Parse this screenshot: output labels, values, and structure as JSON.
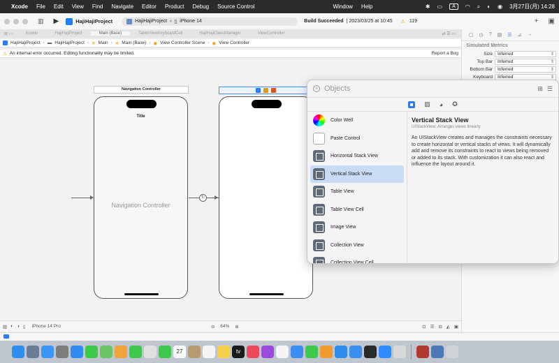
{
  "menubar": {
    "app": "Xcode",
    "items": [
      "File",
      "Edit",
      "View",
      "Find",
      "Navigate",
      "Editor",
      "Product",
      "Debug",
      "Source Control"
    ],
    "right": [
      "Window",
      "Help"
    ],
    "input_source": "A",
    "clock": "3月27日(月)  14:28"
  },
  "toolbar": {
    "project": "HajiHajiProject",
    "scheme": "HajiHajiProject",
    "device": "iPhone 14",
    "status_bold": "Build Succeeded",
    "status_time": "| 2023/03/25 at 10:45",
    "warning_count": "119"
  },
  "tabs": [
    {
      "label": "Assets",
      "active": false
    },
    {
      "label": "HajiHajiProject",
      "active": false
    },
    {
      "label": "Main (Base)",
      "active": true
    },
    {
      "label": "TableViewKeyboardCell",
      "active": false
    },
    {
      "label": "HajiHajiClassManager",
      "active": false
    },
    {
      "label": "ViewController",
      "active": false
    }
  ],
  "jumpbar": {
    "items": [
      "HajiHajiProject",
      "HajiHajiProject",
      "Main",
      "Main (Base)",
      "View Controller Scene",
      "View Controller"
    ]
  },
  "errorbar": {
    "message": "An internal error occurred. Editing functionality may be limited.",
    "report": "Report a Bug"
  },
  "canvas": {
    "nav_scene_title": "Navigation Controller",
    "phone1_title": "Title",
    "phone1_label": "Navigation Controller"
  },
  "bottombar": {
    "device": "iPhone 14 Pro",
    "zoom": "64%"
  },
  "inspector": {
    "section": "Simulated Metrics",
    "rows": [
      {
        "label": "Size",
        "value": "Inferred"
      },
      {
        "label": "Top Bar",
        "value": "Inferred"
      },
      {
        "label": "Bottom Bar",
        "value": "Inferred"
      },
      {
        "label": "Keyboard",
        "value": "Inferred"
      }
    ]
  },
  "library": {
    "placeholder": "Objects",
    "items": [
      {
        "label": "Color Well",
        "kind": "color"
      },
      {
        "label": "Paste Control",
        "kind": "paste"
      },
      {
        "label": "Horizontal Stack View",
        "kind": "std"
      },
      {
        "label": "Vertical Stack View",
        "kind": "std",
        "selected": true
      },
      {
        "label": "Table View",
        "kind": "std"
      },
      {
        "label": "Table View Cell",
        "kind": "std"
      },
      {
        "label": "Image View",
        "kind": "std"
      },
      {
        "label": "Collection View",
        "kind": "std"
      },
      {
        "label": "Collection View Cell",
        "kind": "std"
      }
    ],
    "detail": {
      "title": "Vertical Stack View",
      "subtitle": "UIStackView: Arranges views linearly",
      "description": "An UIStackView creates and manages the constraints necessary to create horizontal or vertical stacks of views. It will dynamically add and remove its constraints to react to views being removed or added to its stack. With customization it can also react and influence the layout around it."
    }
  },
  "dock": {
    "apps": [
      {
        "name": "finder",
        "color": "#2f8cf0",
        "label": ""
      },
      {
        "name": "launchpad",
        "color": "#6b7d96",
        "label": ""
      },
      {
        "name": "mail",
        "color": "#3b95f5",
        "label": ""
      },
      {
        "name": "system-settings",
        "color": "#7d7d7d",
        "label": ""
      },
      {
        "name": "safari",
        "color": "#2f8cf0",
        "label": ""
      },
      {
        "name": "messages",
        "color": "#3ec94b",
        "label": ""
      },
      {
        "name": "maps",
        "color": "#6cc565",
        "label": ""
      },
      {
        "name": "photos",
        "color": "#f2a33a",
        "label": ""
      },
      {
        "name": "facetime",
        "color": "#3ec94b",
        "label": ""
      },
      {
        "name": "chrome",
        "color": "#e0e0e0",
        "label": ""
      },
      {
        "name": "line",
        "color": "#3ec94b",
        "label": ""
      },
      {
        "name": "calendar",
        "color": "#ffffff",
        "label": "27"
      },
      {
        "name": "contacts",
        "color": "#b79a72",
        "label": ""
      },
      {
        "name": "reminders",
        "color": "#f5f5f5",
        "label": ""
      },
      {
        "name": "notes",
        "color": "#f5d24a",
        "label": ""
      },
      {
        "name": "tv",
        "color": "#1a1a1a",
        "label": "tv"
      },
      {
        "name": "music",
        "color": "#f0485b",
        "label": ""
      },
      {
        "name": "podcasts",
        "color": "#9b4ae0",
        "label": ""
      },
      {
        "name": "news",
        "color": "#f5f5f5",
        "label": ""
      },
      {
        "name": "keynote",
        "color": "#3b8ef0",
        "label": ""
      },
      {
        "name": "numbers",
        "color": "#3ec94b",
        "label": ""
      },
      {
        "name": "pages",
        "color": "#f29a2e",
        "label": ""
      },
      {
        "name": "app-store",
        "color": "#2f8cf0",
        "label": ""
      },
      {
        "name": "xcode",
        "color": "#3b8ef0",
        "label": ""
      },
      {
        "name": "terminal",
        "color": "#2a2a2a",
        "label": ""
      },
      {
        "name": "zoom",
        "color": "#2d8cff",
        "label": ""
      },
      {
        "name": "preview",
        "color": "#d8d8d8",
        "label": ""
      },
      {
        "name": "dictionary",
        "color": "#b03a2e",
        "label": ""
      },
      {
        "name": "finder-window",
        "color": "#4a78b8",
        "label": ""
      },
      {
        "name": "trash",
        "color": "#d0d4d8",
        "label": ""
      }
    ]
  }
}
